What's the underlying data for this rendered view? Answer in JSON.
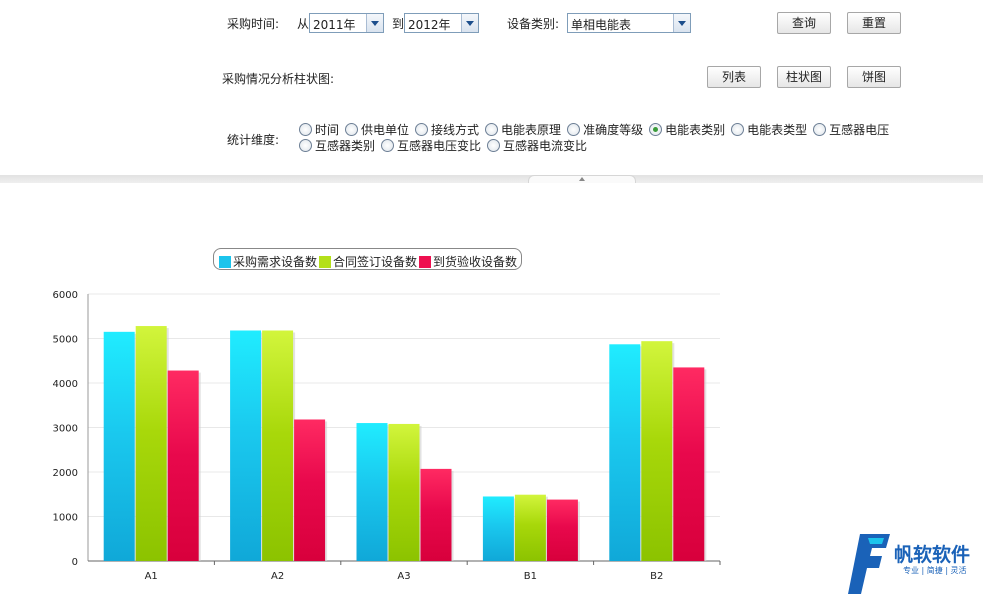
{
  "filters": {
    "time_label": "采购时间:",
    "from_label": "从",
    "from_value": "2011年",
    "to_label": "到",
    "to_value": "2012年",
    "device_type_label": "设备类别:",
    "device_type_value": "单相电能表",
    "query_button": "查询",
    "reset_button": "重置"
  },
  "section": {
    "title": "采购情况分析柱状图:",
    "list_button": "列表",
    "bar_button": "柱状图",
    "pie_button": "饼图"
  },
  "dimension": {
    "label": "统计维度:",
    "options": [
      "时间",
      "供电单位",
      "接线方式",
      "电能表原理",
      "准确度等级",
      "电能表类别",
      "电能表类型",
      "互感器电压",
      "互感器类别",
      "互感器电压变比",
      "互感器电流变比"
    ],
    "selected": "电能表类别"
  },
  "chart_data": {
    "type": "bar",
    "categories": [
      "A1",
      "A2",
      "A3",
      "B1",
      "B2"
    ],
    "series": [
      {
        "name": "采购需求设备数",
        "color": "#1cc4ec",
        "values": [
          5150,
          5180,
          3100,
          1450,
          4870
        ]
      },
      {
        "name": "合同签订设备数",
        "color": "#b4e01a",
        "values": [
          5280,
          5180,
          3080,
          1490,
          4940
        ]
      },
      {
        "name": "到货验收设备数",
        "color": "#ee1050",
        "values": [
          4280,
          3180,
          2070,
          1380,
          4350
        ]
      }
    ],
    "ylim": [
      0,
      6000
    ],
    "yticks": [
      "0",
      "1000",
      "2000",
      "3000",
      "4000",
      "5000",
      "6000"
    ],
    "grid": true,
    "legend": "top"
  },
  "brand": {
    "name": "帆软软件",
    "tagline": "专业 | 简捷 | 灵活",
    "colors": {
      "primary": "#1a62b8",
      "accent": "#1cc4ec"
    }
  }
}
